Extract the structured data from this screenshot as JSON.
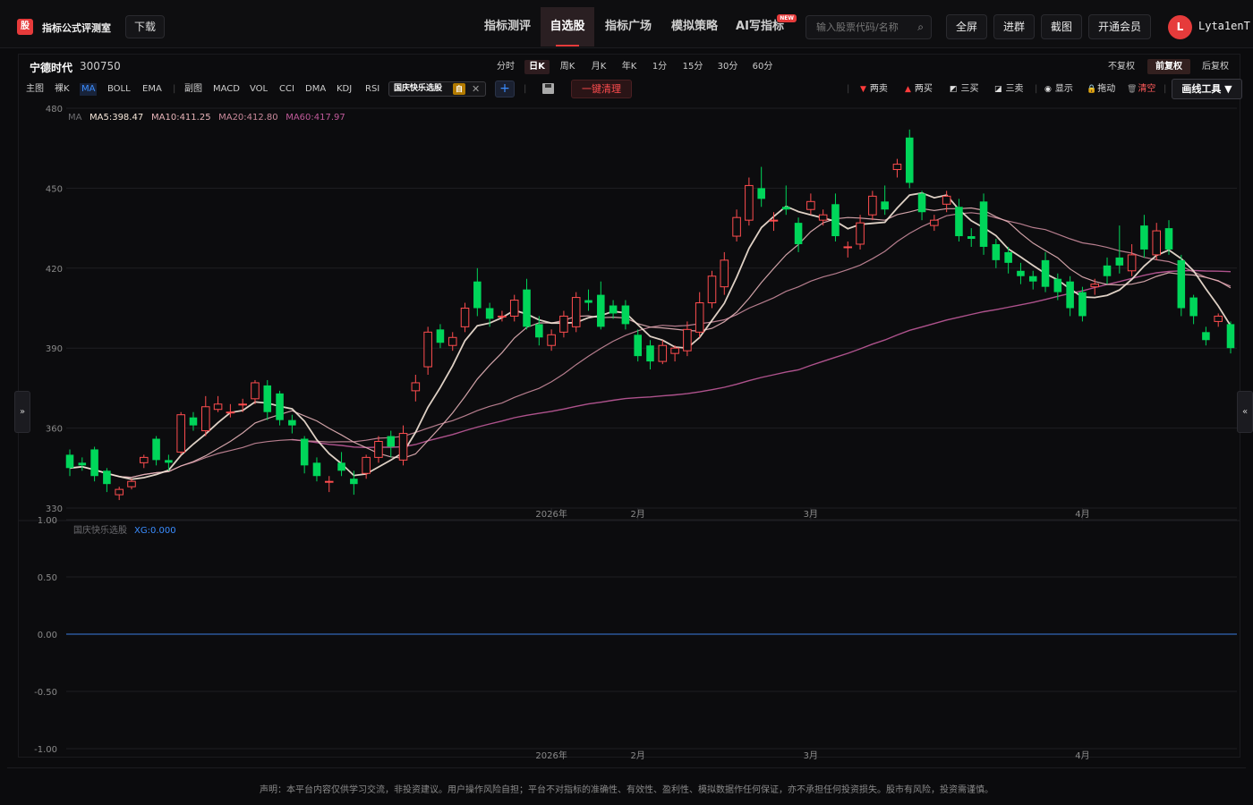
{
  "header": {
    "logo_char": "股",
    "brand": "指标公式评测室",
    "download": "下载",
    "nav": [
      {
        "label": "指标测评",
        "active": false
      },
      {
        "label": "自选股",
        "active": true
      },
      {
        "label": "指标广场",
        "active": false
      },
      {
        "label": "模拟策略",
        "active": false
      },
      {
        "label": "AI写指标",
        "active": false,
        "badge": "NEW"
      }
    ],
    "search_placeholder": "输入股票代码/名称",
    "buttons": [
      "全屏",
      "进群",
      "截图",
      "开通会员"
    ],
    "avatar_initial": "L",
    "username": "Lyta1enT"
  },
  "stock": {
    "name": "宁德时代",
    "code": "300750"
  },
  "periods": [
    {
      "label": "分时",
      "active": false
    },
    {
      "label": "日K",
      "active": true
    },
    {
      "label": "周K",
      "active": false
    },
    {
      "label": "月K",
      "active": false
    },
    {
      "label": "年K",
      "active": false
    },
    {
      "label": "1分",
      "active": false
    },
    {
      "label": "15分",
      "active": false
    },
    {
      "label": "30分",
      "active": false
    },
    {
      "label": "60分",
      "active": false
    }
  ],
  "adjust": [
    {
      "label": "不复权",
      "active": false
    },
    {
      "label": "前复权",
      "active": true
    },
    {
      "label": "后复权",
      "active": false
    }
  ],
  "main_indicators": [
    {
      "label": "主图",
      "active": false
    },
    {
      "label": "裸K",
      "active": false
    },
    {
      "label": "MA",
      "active": true
    },
    {
      "label": "BOLL",
      "active": false
    },
    {
      "label": "EMA",
      "active": false
    }
  ],
  "sub_indicators": [
    "副图",
    "MACD",
    "VOL",
    "CCI",
    "DMA",
    "KDJ",
    "RSI"
  ],
  "custom_indicator": {
    "label": "国庆快乐选股",
    "tag": "自"
  },
  "plus": "+",
  "clear_button": "一键清理",
  "tools": [
    {
      "label": "两卖",
      "icon": "▼",
      "color": "#ff3b3b"
    },
    {
      "label": "两买",
      "icon": "▲",
      "color": "#ff3b3b"
    },
    {
      "label": "三买",
      "icon": "◩",
      "color": "#dddddd"
    },
    {
      "label": "三卖",
      "icon": "◪",
      "color": "#dddddd"
    },
    {
      "label": "显示",
      "icon": "◉",
      "color": "#dddddd"
    },
    {
      "label": "拖动",
      "icon": "🔒",
      "color": "#f0c040"
    },
    {
      "label": "清空",
      "icon": "🗑",
      "color": "#ff5a5a"
    }
  ],
  "draw_tool": "画线工具 ▼",
  "expand_left": "»",
  "expand_right": "«",
  "chart_data": {
    "type": "candlestick",
    "legend": {
      "prefix": "MA",
      "items": [
        {
          "label": "MA5:398.47",
          "color": "#f5e6d8"
        },
        {
          "label": "MA10:411.25",
          "color": "#e6b3b8"
        },
        {
          "label": "MA20:412.80",
          "color": "#c9899b"
        },
        {
          "label": "MA60:417.97",
          "color": "#c05a9a"
        }
      ]
    },
    "y_ticks": [
      "480",
      "450",
      "420",
      "390",
      "360",
      "330"
    ],
    "ylim": [
      330,
      480
    ],
    "x_labels": [
      {
        "label": "2026年",
        "index": 39
      },
      {
        "label": "2月",
        "index": 46
      },
      {
        "label": "3月",
        "index": 60
      },
      {
        "label": "4月",
        "index": 82
      }
    ],
    "up_color": "#ff4d4f",
    "down_color": "#00d65a",
    "candles": [
      [
        350.0,
        345.0,
        352.0,
        342.0
      ],
      [
        347.0,
        346.0,
        349.0,
        344.0
      ],
      [
        352.0,
        342.0,
        353.0,
        340.0
      ],
      [
        344.0,
        339.0,
        345.0,
        336.0
      ],
      [
        335.0,
        337.0,
        338.0,
        333.0
      ],
      [
        338.0,
        340.0,
        341.0,
        337.0
      ],
      [
        347.0,
        349.0,
        350.0,
        345.0
      ],
      [
        356.0,
        348.0,
        357.0,
        346.0
      ],
      [
        348.0,
        347.0,
        350.0,
        344.0
      ],
      [
        351.0,
        365.0,
        366.0,
        350.0
      ],
      [
        364.0,
        361.0,
        366.0,
        359.0
      ],
      [
        359.0,
        368.0,
        372.0,
        357.0
      ],
      [
        367.0,
        369.0,
        372.0,
        366.0
      ],
      [
        366.0,
        366.0,
        369.0,
        364.0
      ],
      [
        369.0,
        369.0,
        371.0,
        366.0
      ],
      [
        371.0,
        377.0,
        378.0,
        369.0
      ],
      [
        376.0,
        366.0,
        378.0,
        363.0
      ],
      [
        373.0,
        363.0,
        374.0,
        361.0
      ],
      [
        363.0,
        361.0,
        365.0,
        358.0
      ],
      [
        356.0,
        346.0,
        357.0,
        343.0
      ],
      [
        347.0,
        342.0,
        349.0,
        340.0
      ],
      [
        340.0,
        340.0,
        342.0,
        336.0
      ],
      [
        347.0,
        344.0,
        351.0,
        342.0
      ],
      [
        341.0,
        339.0,
        344.0,
        335.0
      ],
      [
        343.0,
        349.0,
        350.0,
        341.0
      ],
      [
        349.0,
        355.0,
        357.0,
        347.0
      ],
      [
        357.0,
        353.0,
        359.0,
        349.0
      ],
      [
        348.0,
        358.0,
        361.0,
        346.0
      ],
      [
        374.0,
        377.0,
        380.0,
        370.0
      ],
      [
        383.0,
        396.0,
        398.0,
        380.0
      ],
      [
        397.0,
        392.0,
        399.0,
        390.0
      ],
      [
        391.0,
        394.0,
        396.0,
        389.0
      ],
      [
        398.0,
        405.0,
        407.0,
        396.0
      ],
      [
        415.0,
        405.0,
        420.0,
        402.0
      ],
      [
        405.0,
        401.0,
        407.0,
        398.0
      ],
      [
        402.0,
        402.0,
        404.0,
        400.0
      ],
      [
        402.0,
        408.0,
        410.0,
        400.0
      ],
      [
        412.0,
        398.0,
        416.0,
        397.0
      ],
      [
        399.0,
        394.0,
        402.0,
        391.0
      ],
      [
        391.0,
        395.0,
        397.0,
        389.0
      ],
      [
        396.0,
        402.0,
        404.0,
        394.0
      ],
      [
        398.0,
        409.0,
        411.0,
        396.0
      ],
      [
        408.0,
        407.0,
        412.0,
        404.0
      ],
      [
        410.0,
        398.0,
        415.0,
        397.0
      ],
      [
        406.0,
        403.0,
        408.0,
        401.0
      ],
      [
        406.0,
        399.0,
        408.0,
        397.0
      ],
      [
        395.0,
        387.0,
        397.0,
        385.0
      ],
      [
        391.0,
        385.0,
        393.0,
        382.0
      ],
      [
        385.0,
        391.0,
        393.0,
        384.0
      ],
      [
        388.0,
        390.0,
        391.0,
        385.0
      ],
      [
        389.0,
        397.0,
        400.0,
        387.0
      ],
      [
        396.0,
        407.0,
        411.0,
        394.0
      ],
      [
        407.0,
        417.0,
        419.0,
        405.0
      ],
      [
        413.0,
        423.0,
        426.0,
        410.0
      ],
      [
        432.0,
        439.0,
        442.0,
        430.0
      ],
      [
        438.0,
        451.0,
        454.0,
        436.0
      ],
      [
        450.0,
        446.0,
        458.0,
        443.0
      ],
      [
        438.0,
        438.0,
        441.0,
        434.0
      ],
      [
        443.0,
        442.0,
        451.0,
        440.0
      ],
      [
        437.0,
        429.0,
        439.0,
        426.0
      ],
      [
        442.0,
        445.0,
        448.0,
        440.0
      ],
      [
        438.0,
        440.0,
        442.0,
        436.0
      ],
      [
        444.0,
        432.0,
        448.0,
        430.0
      ],
      [
        428.0,
        428.0,
        430.0,
        424.0
      ],
      [
        429.0,
        437.0,
        440.0,
        427.0
      ],
      [
        440.0,
        447.0,
        449.0,
        438.0
      ],
      [
        445.0,
        442.0,
        451.0,
        440.0
      ],
      [
        457.0,
        459.0,
        461.0,
        454.0
      ],
      [
        469.0,
        452.0,
        472.0,
        450.0
      ],
      [
        448.0,
        441.0,
        449.0,
        438.0
      ],
      [
        436.0,
        438.0,
        440.0,
        434.0
      ],
      [
        444.0,
        447.0,
        449.0,
        441.0
      ],
      [
        443.0,
        432.0,
        446.0,
        430.0
      ],
      [
        432.0,
        431.0,
        435.0,
        428.0
      ],
      [
        445.0,
        428.0,
        448.0,
        425.0
      ],
      [
        429.0,
        423.0,
        431.0,
        420.0
      ],
      [
        426.0,
        422.0,
        428.0,
        418.0
      ],
      [
        419.0,
        417.0,
        422.0,
        414.0
      ],
      [
        417.0,
        415.0,
        419.0,
        412.0
      ],
      [
        423.0,
        413.0,
        426.0,
        411.0
      ],
      [
        416.0,
        411.0,
        418.0,
        408.0
      ],
      [
        415.0,
        405.0,
        417.0,
        402.0
      ],
      [
        411.0,
        402.0,
        413.0,
        400.0
      ],
      [
        413.0,
        414.0,
        416.0,
        410.0
      ],
      [
        421.0,
        417.0,
        424.0,
        414.0
      ],
      [
        424.0,
        421.0,
        436.0,
        418.0
      ],
      [
        419.0,
        425.0,
        429.0,
        417.0
      ],
      [
        436.0,
        427.0,
        440.0,
        424.0
      ],
      [
        425.0,
        434.0,
        437.0,
        423.0
      ],
      [
        435.0,
        427.0,
        438.0,
        425.0
      ],
      [
        423.0,
        405.0,
        425.0,
        402.0
      ],
      [
        409.0,
        402.0,
        410.0,
        399.0
      ],
      [
        396.0,
        393.0,
        398.0,
        391.0
      ],
      [
        400.0,
        402.0,
        403.0,
        398.0
      ],
      [
        399.0,
        390.0,
        400.0,
        388.0
      ]
    ],
    "sub_chart": {
      "name": "国庆快乐选股",
      "value_label": "XG:0.000",
      "y_ticks": [
        "1.00",
        "0.50",
        "0.00",
        "-0.50",
        "-1.00"
      ],
      "ylim": [
        -1,
        1
      ],
      "series": [
        {
          "name": "XG",
          "value": 0
        }
      ]
    }
  },
  "disclaimer": "声明：本平台内容仅供学习交流，非投资建议。用户操作风险自担；平台不对指标的准确性、有效性、盈利性、模拟数据作任何保证，亦不承担任何投资损失。股市有风险，投资需谨慎。"
}
